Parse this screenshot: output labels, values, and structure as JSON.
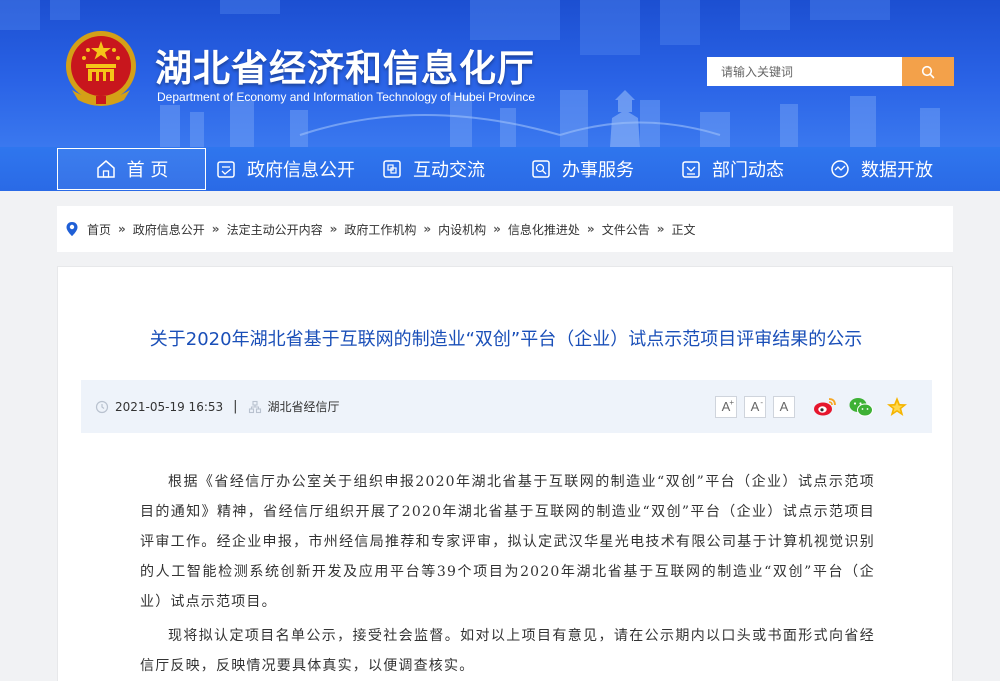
{
  "header": {
    "site_title": "湖北省经济和信息化厅",
    "site_subtitle": "Department of Economy and Information Technology of Hubei Province",
    "search_placeholder": "请输入关键词"
  },
  "nav": {
    "items": [
      {
        "label": "首 页",
        "icon": "home-icon"
      },
      {
        "label": "政府信息公开",
        "icon": "document-icon"
      },
      {
        "label": "互动交流",
        "icon": "interaction-icon"
      },
      {
        "label": "办事服务",
        "icon": "service-search-icon"
      },
      {
        "label": "部门动态",
        "icon": "news-icon"
      },
      {
        "label": "数据开放",
        "icon": "data-icon"
      }
    ],
    "active_index": 0
  },
  "breadcrumb": {
    "icon": "location-pin-icon",
    "items": [
      "首页",
      "政府信息公开",
      "法定主动公开内容",
      "政府工作机构",
      "内设机构",
      "信息化推进处",
      "文件公告",
      "正文"
    ],
    "separator": "»"
  },
  "article": {
    "title": "关于2020年湖北省基于互联网的制造业“双创”平台（企业）试点示范项目评审结果的公示",
    "date": "2021-05-19 16:53",
    "source": "湖北省经信厅",
    "font_size_buttons": [
      "A",
      "A",
      "A"
    ],
    "share_icons": [
      "weibo-icon",
      "wechat-icon",
      "favorite-star-icon"
    ],
    "paragraphs": [
      "根据《省经信厅办公室关于组织申报2020年湖北省基于互联网的制造业“双创”平台（企业）试点示范项目的通知》精神，省经信厅组织开展了2020年湖北省基于互联网的制造业“双创”平台（企业）试点示范项目评审工作。经企业申报，市州经信局推荐和专家评审，拟认定武汉华星光电技术有限公司基于计算机视觉识别的人工智能检测系统创新开发及应用平台等39个项目为2020年湖北省基于互联网的制造业“双创”平台（企业）试点示范项目。",
      "现将拟认定项目名单公示，接受社会监督。如对以上项目有意见，请在公示期内以口头或书面形式向省经信厅反映，反映情况要具体真实，以便调查核实。"
    ]
  },
  "colors": {
    "banner_blue": "#2a63e6",
    "nav_blue": "#2f76ee",
    "title_blue": "#1a4fb8",
    "search_orange": "#f3a14a",
    "meta_bg": "#eef3fa"
  }
}
